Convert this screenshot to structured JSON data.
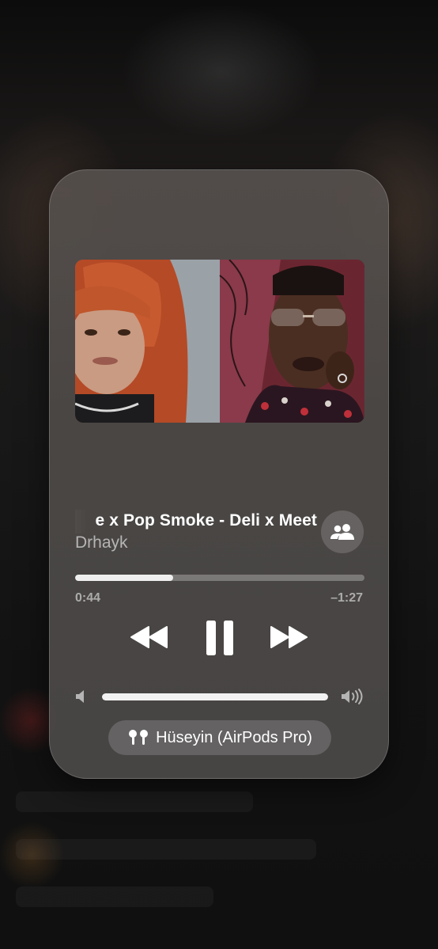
{
  "now_playing": {
    "title": "e x Pop Smoke - Deli x Meet",
    "artist": "Drhayk",
    "progress": 0.34,
    "elapsed": "0:44",
    "remaining": "–1:27",
    "volume": 1.0
  },
  "output_device": {
    "label": "Hüseyin (AirPods Pro)",
    "icon": "airpods-icon"
  },
  "icons": {
    "share": "shareplay-people-icon",
    "rewind": "rewind-icon",
    "pause": "pause-icon",
    "forward": "fast-forward-icon",
    "volume_low": "speaker-low-icon",
    "volume_high": "speaker-high-icon"
  },
  "colors": {
    "card_background": "#524d4b",
    "progress_fill": "#e0e0e0",
    "text_primary": "#ffffff",
    "text_secondary": "#a8a6a5"
  }
}
